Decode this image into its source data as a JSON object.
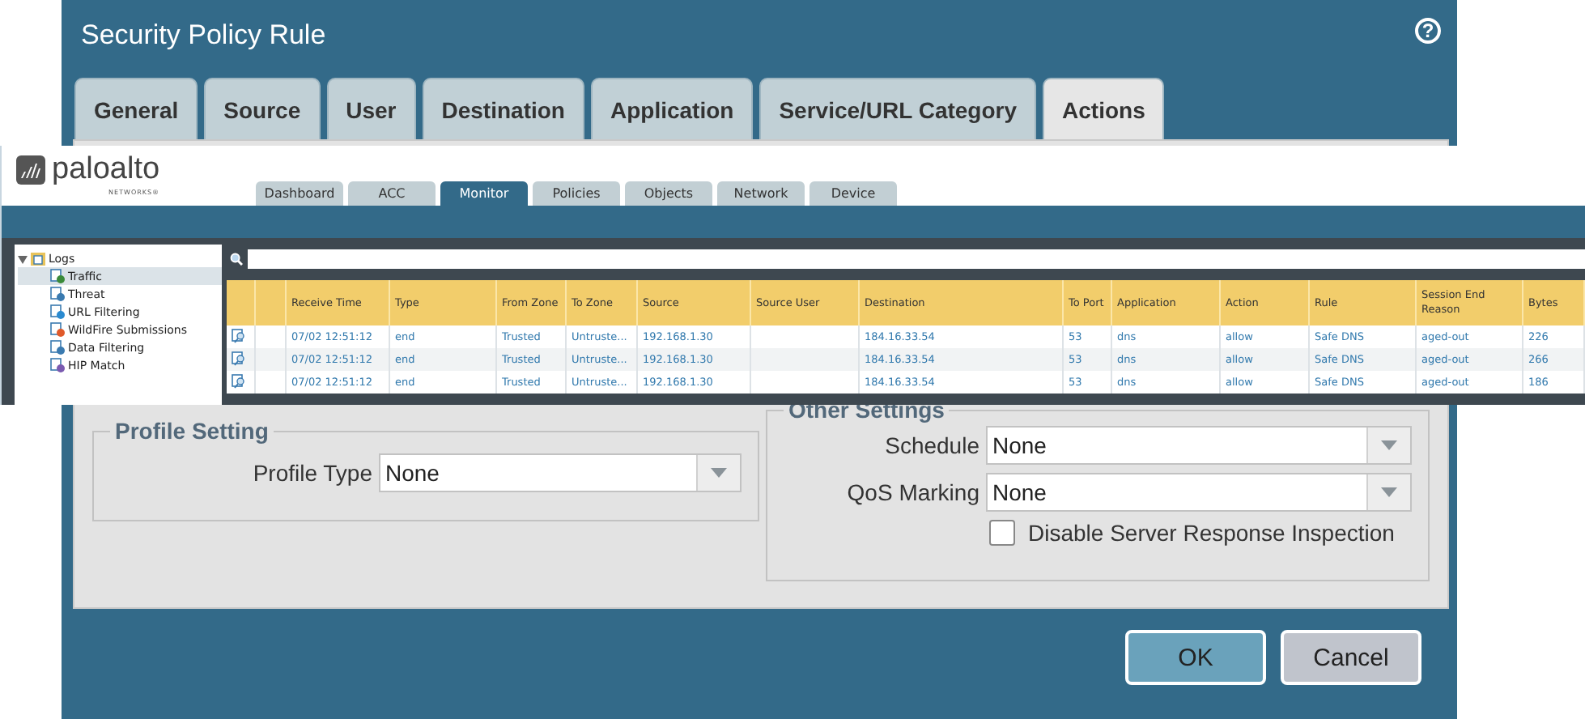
{
  "dialog": {
    "title": "Security Policy Rule",
    "help": "?",
    "tabs": [
      {
        "label": "General",
        "selected": false
      },
      {
        "label": "Source",
        "selected": false
      },
      {
        "label": "User",
        "selected": false
      },
      {
        "label": "Destination",
        "selected": false
      },
      {
        "label": "Application",
        "selected": false
      },
      {
        "label": "Service/URL Category",
        "selected": false
      },
      {
        "label": "Actions",
        "selected": true
      }
    ],
    "profile_setting": {
      "legend": "Profile Setting",
      "profile_type": {
        "label": "Profile Type",
        "value": "None"
      }
    },
    "other_settings": {
      "legend": "Other Settings",
      "schedule": {
        "label": "Schedule",
        "value": "None"
      },
      "qos_marking": {
        "label": "QoS Marking",
        "value": "None"
      },
      "disable_server_response_inspection": {
        "label": "Disable Server Response Inspection",
        "checked": false
      }
    },
    "buttons": [
      {
        "label": "OK",
        "kind": "primary"
      },
      {
        "label": "Cancel",
        "kind": "secondary"
      }
    ]
  },
  "monitor": {
    "logo": {
      "name": "paloalto",
      "tagline": "NETWORKS®"
    },
    "tabs": [
      {
        "label": "Dashboard",
        "selected": false
      },
      {
        "label": "ACC",
        "selected": false
      },
      {
        "label": "Monitor",
        "selected": true
      },
      {
        "label": "Policies",
        "selected": false
      },
      {
        "label": "Objects",
        "selected": false
      },
      {
        "label": "Network",
        "selected": false
      },
      {
        "label": "Device",
        "selected": false
      }
    ],
    "log_tree": {
      "label": "Logs",
      "expanded": true,
      "children": [
        {
          "label": "Traffic",
          "selected": true
        },
        {
          "label": "Threat",
          "selected": false
        },
        {
          "label": "URL Filtering",
          "selected": false
        },
        {
          "label": "WildFire Submissions",
          "selected": false
        },
        {
          "label": "Data Filtering",
          "selected": false
        },
        {
          "label": "HIP Match",
          "selected": false
        }
      ]
    },
    "table": {
      "columns": [
        "Receive Time",
        "Type",
        "From Zone",
        "To Zone",
        "Source",
        "Source User",
        "Destination",
        "To Port",
        "Application",
        "Action",
        "Rule",
        "Session End Reason",
        "Bytes"
      ],
      "rows": [
        [
          "07/02 12:51:12",
          "end",
          "Trusted",
          "Untruste...",
          "192.168.1.30",
          "",
          "184.16.33.54",
          "53",
          "dns",
          "allow",
          "Safe DNS",
          "aged-out",
          "226"
        ],
        [
          "07/02 12:51:12",
          "end",
          "Trusted",
          "Untruste...",
          "192.168.1.30",
          "",
          "184.16.33.54",
          "53",
          "dns",
          "allow",
          "Safe DNS",
          "aged-out",
          "266"
        ],
        [
          "07/02 12:51:12",
          "end",
          "Trusted",
          "Untruste...",
          "192.168.1.30",
          "",
          "184.16.33.54",
          "53",
          "dns",
          "allow",
          "Safe DNS",
          "aged-out",
          "186"
        ]
      ]
    }
  }
}
